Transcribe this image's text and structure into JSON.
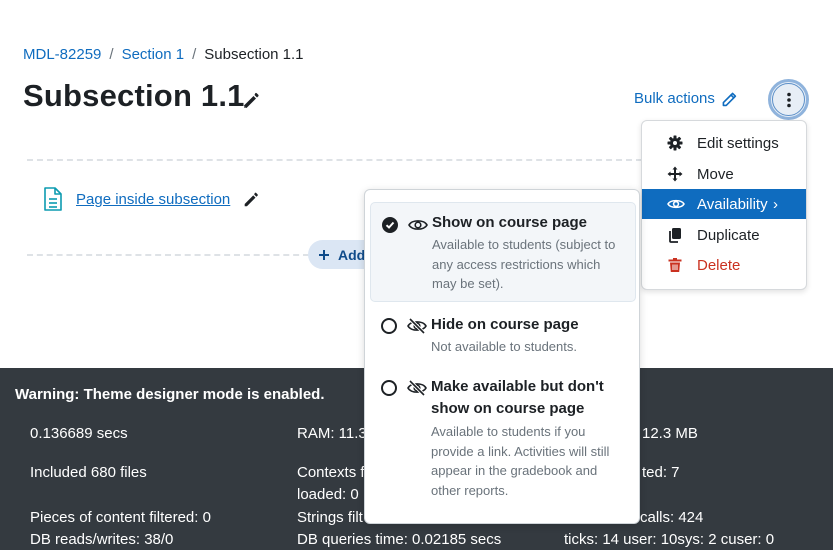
{
  "breadcrumb": {
    "course": "MDL-82259",
    "section": "Section 1",
    "current": "Subsection 1.1",
    "separator": "/"
  },
  "page_title": "Subsection 1.1",
  "bulk_actions_label": "Bulk actions",
  "activity": {
    "name": "Page inside subsection"
  },
  "add_button_label": "Add",
  "action_menu": {
    "items": [
      {
        "label": "Edit settings",
        "icon": "gear-icon"
      },
      {
        "label": "Move",
        "icon": "move-arrows-icon"
      },
      {
        "label": "Availability",
        "icon": "eye-icon",
        "active": true
      },
      {
        "label": "Duplicate",
        "icon": "copy-icon"
      },
      {
        "label": "Delete",
        "icon": "trash-icon",
        "danger": true
      }
    ],
    "chevron": "›"
  },
  "availability_menu": {
    "options": [
      {
        "title": "Show on course page",
        "description": "Available to students (subject to any access restrictions which may be set).",
        "selected": true,
        "icon": "eye-icon"
      },
      {
        "title": "Hide on course page",
        "description": "Not available to students.",
        "selected": false,
        "icon": "eye-slash-icon"
      },
      {
        "title": "Make available but don't show on course page",
        "description": "Available to students if you provide a link. Activities will still appear in the gradebook and other reports.",
        "selected": false,
        "icon": "eye-slash-icon"
      }
    ]
  },
  "footer": {
    "warning": "Warning: Theme designer mode is enabled.",
    "secs": "0.136689 secs",
    "ram": "RAM: 11.3",
    "peak_ram": "12.3 MB",
    "included_files": "Included 680 files",
    "contexts_line1": "Contexts f",
    "contexts_line2": "loaded: 0",
    "contexts_right": "ted: 7",
    "filtered": "Pieces of content filtered: 0",
    "strings": "Strings filt",
    "calls": "calls: 424",
    "db_reads": "DB reads/writes: 38/0",
    "db_time": "DB queries time: 0.02185 secs",
    "ticks": "ticks: 14 user: 10sys: 2 cuser: 0"
  },
  "colors": {
    "link": "#0f6cbf",
    "active": "#0f6cbf",
    "danger": "#ca3120",
    "footer_bg": "#343a40"
  }
}
